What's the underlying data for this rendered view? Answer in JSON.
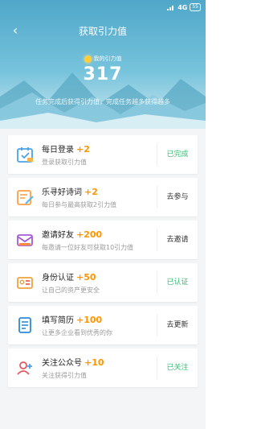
{
  "status_bar": {
    "network": "4G",
    "battery": "55"
  },
  "header": {
    "title": "获取引力值",
    "score_label": "我的引力值",
    "score": "317",
    "tip": "任务完成后获得引力值，完成任务越多获得越多"
  },
  "tasks": [
    {
      "icon": "calendar-check-icon",
      "name": "每日登录",
      "points": "+2",
      "desc": "登录获取引力值",
      "action": "已完成",
      "status": "done"
    },
    {
      "icon": "poem-pen-icon",
      "name": "乐寻好诗词",
      "points": "+2",
      "desc": "每日参与最高获取2引力值",
      "action": "去参与",
      "status": "todo"
    },
    {
      "icon": "invite-mail-icon",
      "name": "邀请好友",
      "points": "+200",
      "desc": "每邀请一位好友可获取10引力值",
      "action": "去邀请",
      "status": "todo"
    },
    {
      "icon": "id-card-icon",
      "name": "身份认证",
      "points": "+50",
      "desc": "让自己的资产更安全",
      "action": "已认证",
      "status": "done"
    },
    {
      "icon": "resume-icon",
      "name": "填写简历",
      "points": "+100",
      "desc": "让更多企业看到优秀的你",
      "action": "去更新",
      "status": "todo"
    },
    {
      "icon": "follow-user-icon",
      "name": "关注公众号",
      "points": "+10",
      "desc": "关注获得引力值",
      "action": "已关注",
      "status": "done"
    }
  ],
  "colors": {
    "accent_points": "#ff9500",
    "done": "#2fbf71",
    "header_top": "#4fa7c9"
  }
}
